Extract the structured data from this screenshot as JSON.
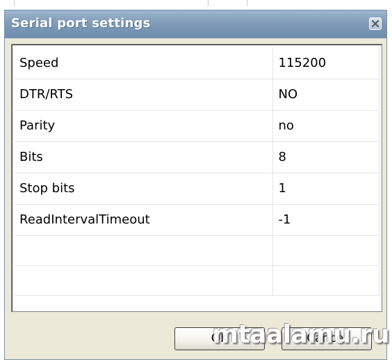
{
  "dialog": {
    "title": "Serial port settings",
    "close_icon": "close-icon"
  },
  "settings": [
    {
      "name": "Speed",
      "value": "115200"
    },
    {
      "name": "DTR/RTS",
      "value": "NO"
    },
    {
      "name": "Parity",
      "value": "no"
    },
    {
      "name": "Bits",
      "value": "8"
    },
    {
      "name": "Stop bits",
      "value": "1"
    },
    {
      "name": "ReadIntervalTimeout",
      "value": "-1"
    }
  ],
  "buttons": {
    "ok_label": "OK",
    "cancel_label": "Cancel"
  },
  "watermark": "mtaalamu.ru",
  "colors": {
    "titlebar": "#7f9bb8",
    "dialog_bg": "#ece9d8",
    "grid_bg": "#ffffff"
  }
}
